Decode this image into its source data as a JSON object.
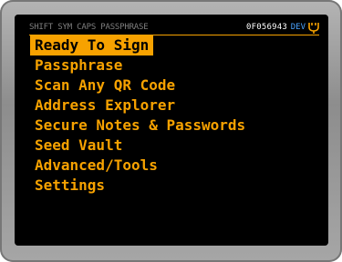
{
  "status_bar": {
    "modifiers": "SHIFT SYM CAPS  PASSPHRASE",
    "device_id": "0F056943",
    "dev_badge": "DEV",
    "usb_icon": "plug-icon"
  },
  "colors": {
    "accent": "#f7a200",
    "background": "#000000",
    "modifier_text": "#7f7f7f",
    "dev_badge": "#4aa3ff"
  },
  "menu": {
    "selected_index": 0,
    "items": [
      {
        "label": "Ready To Sign"
      },
      {
        "label": "Passphrase"
      },
      {
        "label": "Scan Any QR Code"
      },
      {
        "label": "Address Explorer"
      },
      {
        "label": "Secure Notes & Passwords"
      },
      {
        "label": "Seed Vault"
      },
      {
        "label": "Advanced/Tools"
      },
      {
        "label": "Settings"
      }
    ]
  }
}
